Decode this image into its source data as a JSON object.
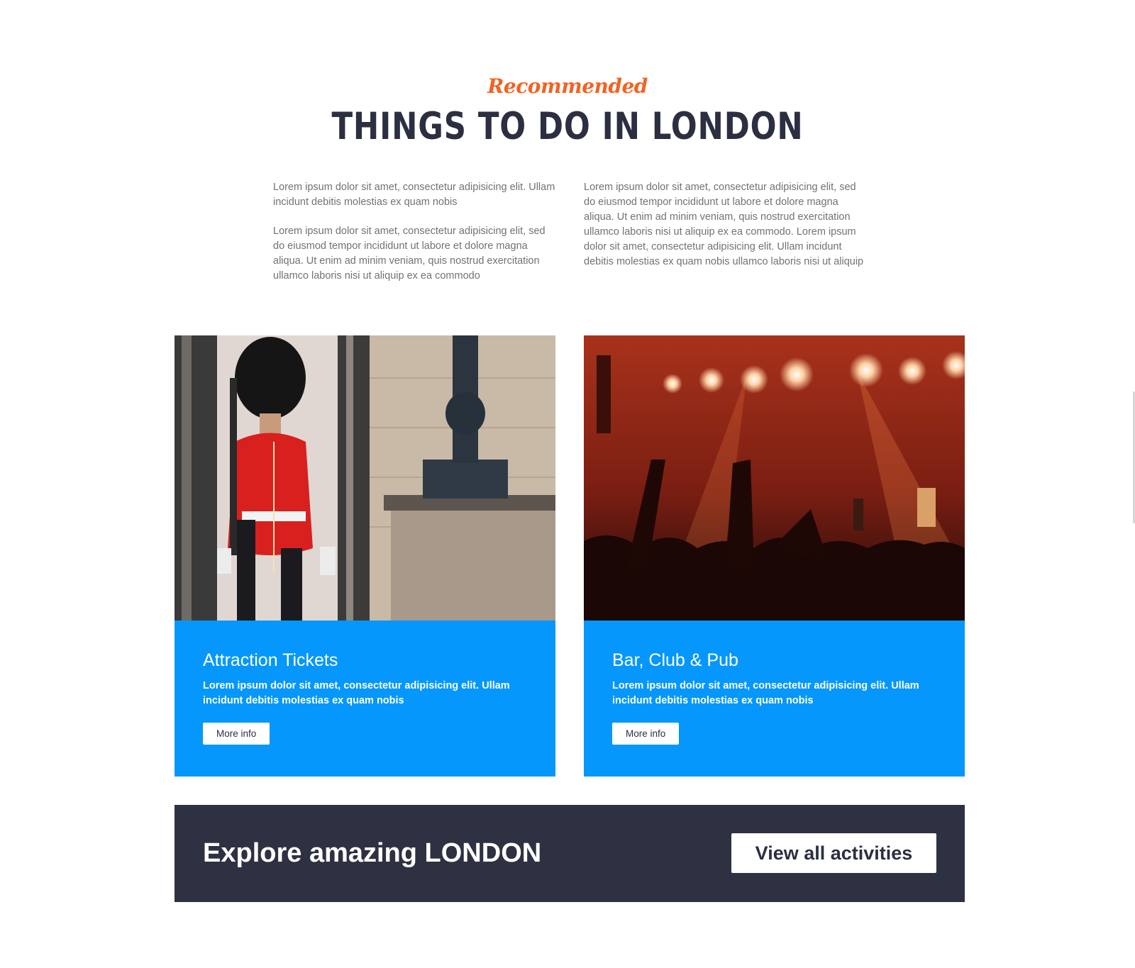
{
  "header": {
    "eyebrow": "Recommended",
    "title": "THINGS TO DO IN LONDON"
  },
  "intro": {
    "left_paragraphs": [
      "Lorem ipsum dolor sit amet, consectetur adipisicing elit. Ullam incidunt debitis molestias ex quam nobis",
      "Lorem ipsum dolor sit amet, consectetur adipisicing elit, sed do eiusmod tempor incididunt ut labore et dolore magna aliqua. Ut enim ad minim veniam, quis nostrud exercitation ullamco laboris nisi ut aliquip ex ea commodo"
    ],
    "right_paragraph": "Lorem ipsum dolor sit amet, consectetur adipisicing elit, sed do eiusmod tempor incididunt ut labore et dolore magna aliqua. Ut enim ad minim veniam, quis nostrud exercitation ullamco laboris nisi ut aliquip ex ea commodo. Lorem ipsum dolor sit amet, consectetur adipisicing elit. Ullam incidunt debitis molestias ex quam nobis ullamco laboris nisi ut aliquip"
  },
  "cards": [
    {
      "title": "Attraction Tickets",
      "text": "Lorem ipsum dolor sit amet, consectetur adipisicing elit. Ullam incidunt debitis molestias ex quam nobis",
      "button_label": "More info"
    },
    {
      "title": "Bar, Club & Pub",
      "text": "Lorem ipsum dolor sit amet, consectetur adipisicing elit. Ullam incidunt debitis molestias ex quam nobis",
      "button_label": "More info"
    }
  ],
  "cta": {
    "text": "Explore amazing LONDON",
    "button_label": "View all activities"
  },
  "colors": {
    "accent_orange": "#f26322",
    "heading_navy": "#2b2f41",
    "card_blue": "#0597fb",
    "cta_background": "#2e3142"
  }
}
